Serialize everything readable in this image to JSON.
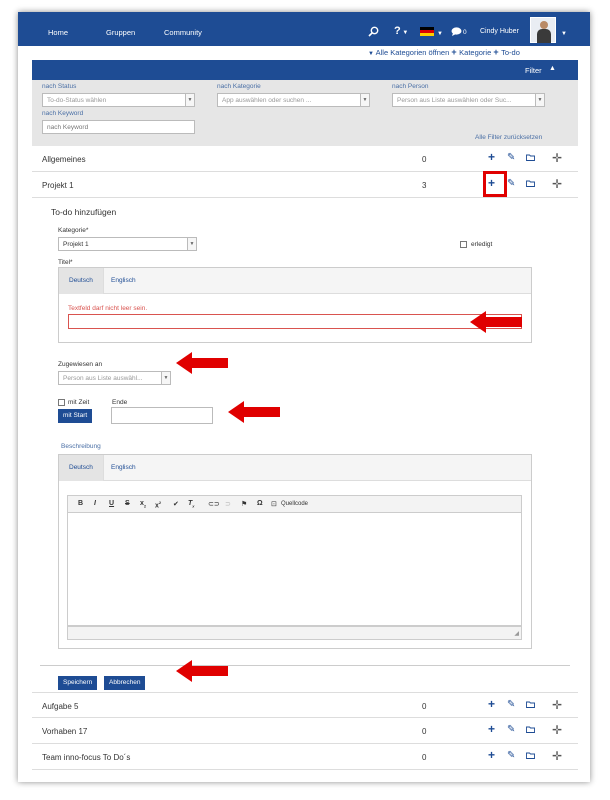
{
  "topbar": {
    "nav": [
      "Home",
      "Gruppen",
      "Community"
    ],
    "search_icon": "search-icon",
    "help_label": "?",
    "language_flag": "german-flag-icon",
    "chat_count": "0",
    "user_name": "Cindy Huber"
  },
  "subnav": {
    "open_all": "Alle Kategorien öffnen",
    "add_category": "Kategorie",
    "add_todo": "To-do"
  },
  "filter": {
    "title": "Filter",
    "status_label": "nach Status",
    "status_placeholder": "To-do-Status wählen",
    "category_label": "nach Kategorie",
    "category_placeholder": "App auswählen oder suchen ...",
    "person_label": "nach Person",
    "person_placeholder": "Person aus Liste auswählen oder Suc...",
    "keyword_label": "nach Keyword",
    "keyword_placeholder": "nach Keyword",
    "reset": "Alle Filter zurücksetzen"
  },
  "categories_top": [
    {
      "name": "Allgemeines",
      "count": "0"
    },
    {
      "name": "Projekt 1",
      "count": "3"
    }
  ],
  "form": {
    "title": "To-do hinzufügen",
    "category_label": "Kategorie*",
    "category_value": "Projekt 1",
    "done_label": "erledigt",
    "title_label": "Titel*",
    "tab_de": "Deutsch",
    "tab_en": "Englisch",
    "error": "Textfeld darf nicht leer sein.",
    "assigned_label": "Zugewiesen an",
    "assigned_placeholder": "Person aus Liste auswähl...",
    "with_time": "mit Zeit",
    "end_label": "Ende",
    "start_button": "mit Start",
    "desc_label": "Beschreibung",
    "desc_tab_de": "Deutsch",
    "desc_tab_en": "Englisch",
    "source_label": "Quellcode",
    "save": "Speichern",
    "cancel": "Abbrechen"
  },
  "categories_bottom": [
    {
      "name": "Aufgabe 5",
      "count": "0"
    },
    {
      "name": "Vorhaben 17",
      "count": "0"
    },
    {
      "name": "Team inno-focus To Do´s",
      "count": "0"
    }
  ],
  "colors": {
    "brand": "#1e4c94",
    "annotation": "#e00000",
    "error": "#d9534f"
  }
}
